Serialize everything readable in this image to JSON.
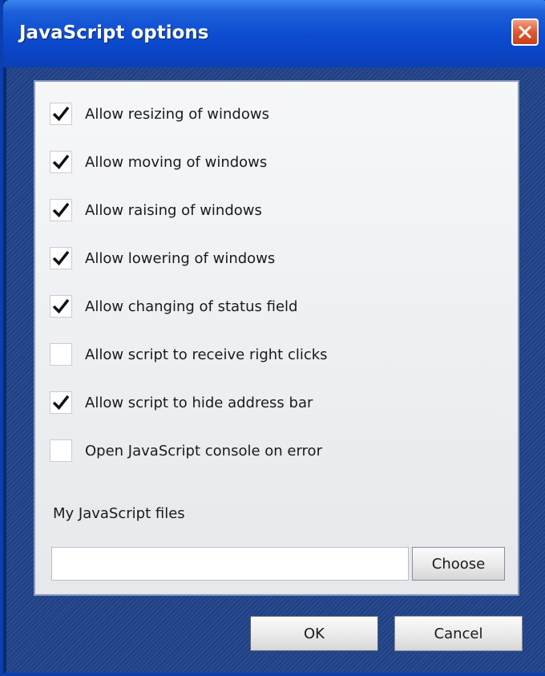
{
  "window": {
    "title": "JavaScript options"
  },
  "options": [
    {
      "label": "Allow resizing of windows",
      "checked": true
    },
    {
      "label": "Allow moving of windows",
      "checked": true
    },
    {
      "label": "Allow raising of windows",
      "checked": true
    },
    {
      "label": "Allow lowering of windows",
      "checked": true
    },
    {
      "label": "Allow changing of status field",
      "checked": true
    },
    {
      "label": "Allow script to receive right clicks",
      "checked": false
    },
    {
      "label": "Allow script to hide address bar",
      "checked": true
    },
    {
      "label": "Open JavaScript console on error",
      "checked": false
    }
  ],
  "files": {
    "label": "My JavaScript files",
    "value": "",
    "choose_label": "Choose"
  },
  "buttons": {
    "ok_label": "OK",
    "cancel_label": "Cancel"
  },
  "colors": {
    "titlebar": "#0c4bd0",
    "client_background": "#2a4c90",
    "close_button": "#e0582e",
    "panel_background": "#eef0f3"
  },
  "icons": {
    "close": "close-icon",
    "check": "checkmark-icon"
  }
}
